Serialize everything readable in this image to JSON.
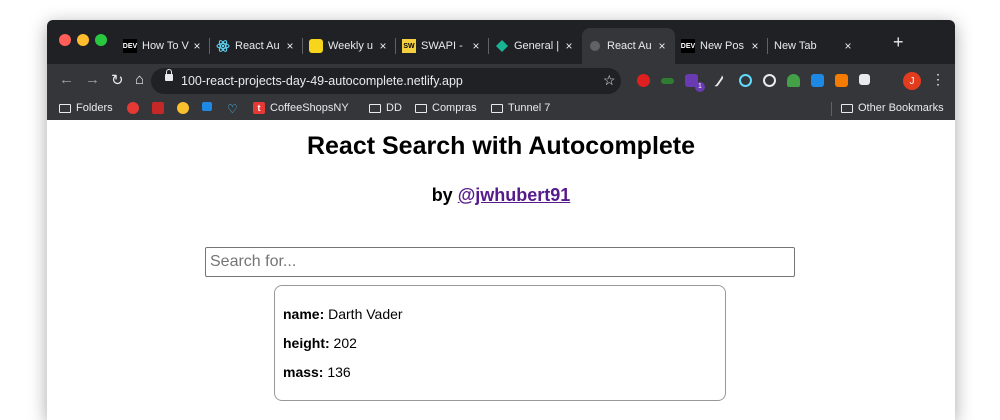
{
  "browser": {
    "tabs": [
      {
        "label": "How To V",
        "favicon": "DEV"
      },
      {
        "label": "React Au",
        "favicon": "react-icon"
      },
      {
        "label": "Weekly u",
        "favicon": "notes-icon"
      },
      {
        "label": "SWAPI -",
        "favicon": "SW"
      },
      {
        "label": "General |",
        "favicon": "diamond-icon"
      },
      {
        "label": "React Au",
        "favicon": "globe-icon",
        "active": true
      },
      {
        "label": "New Pos",
        "favicon": "DEV"
      },
      {
        "label": "New Tab",
        "favicon": ""
      }
    ],
    "close_glyph": "×",
    "new_tab_glyph": "+",
    "nav": {
      "back": "←",
      "forward": "→",
      "reload": "↻",
      "home": "⌂"
    },
    "url": "100-react-projects-day-49-autocomplete.netlify.app",
    "bookmark_star": "☆",
    "profile_initial": "J",
    "menu_glyph": "⋮",
    "extension_badge": "1",
    "bookmarks": [
      {
        "label": "Folders",
        "type": "folder"
      },
      {
        "label": "CoffeeShopsNY",
        "type": "link"
      },
      {
        "label": "DD",
        "type": "folder"
      },
      {
        "label": "Compras",
        "type": "folder"
      },
      {
        "label": "Tunnel 7",
        "type": "folder"
      }
    ],
    "other_bookmarks": "Other Bookmarks",
    "bookmark_favicon_letter": "t",
    "accent_colors": {
      "close": "#ff5f57",
      "minimize": "#febc2e",
      "maximize": "#28c840"
    }
  },
  "page": {
    "title": "React Search with Autocomplete",
    "byline_prefix": "by",
    "author_link": "@jwhubert91",
    "search_placeholder": "Search for...",
    "result": [
      {
        "label": "name:",
        "value": "Darth Vader"
      },
      {
        "label": "height:",
        "value": "202"
      },
      {
        "label": "mass:",
        "value": "136"
      }
    ]
  }
}
